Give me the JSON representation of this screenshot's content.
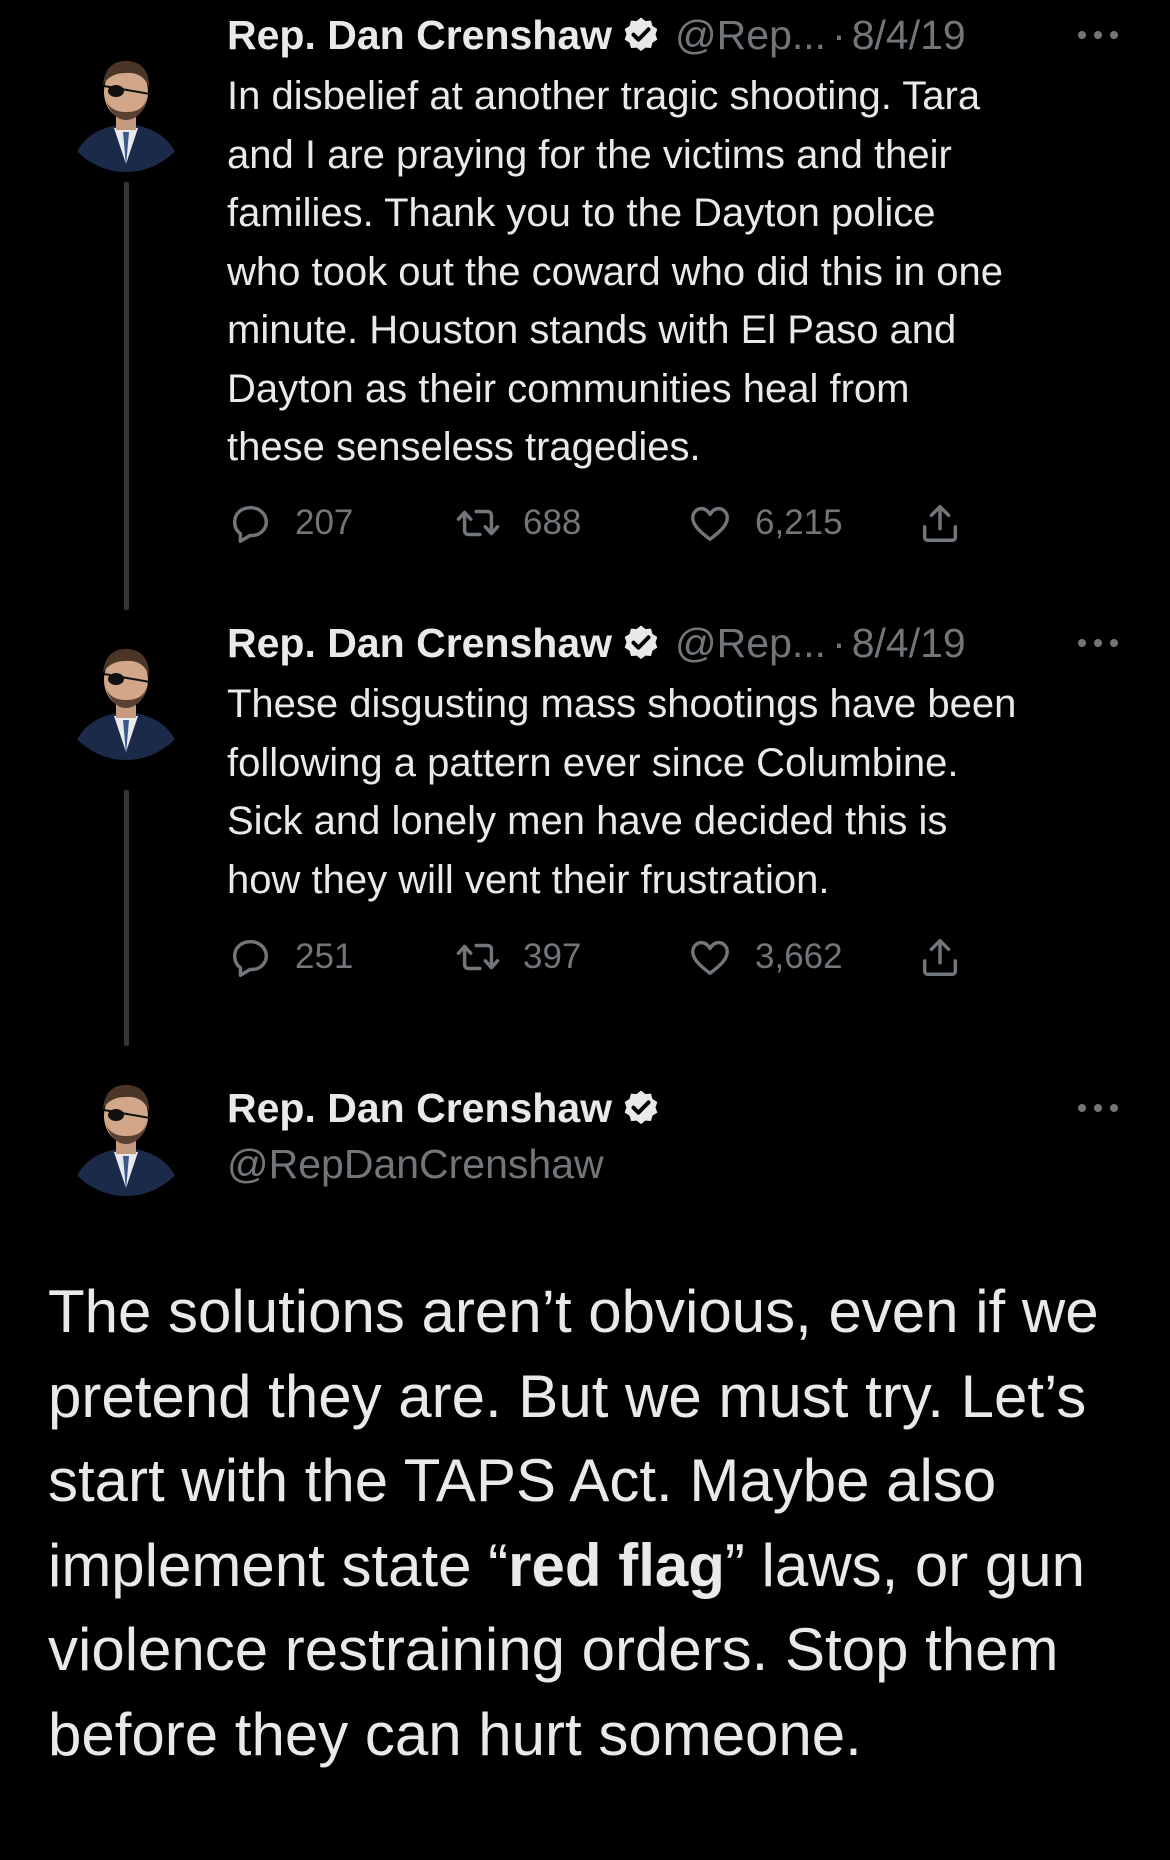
{
  "colors": {
    "background": "#000000",
    "text": "#e7e9ea",
    "secondary_text": "#71767b",
    "thread_line": "#333639",
    "verified_badge": "#e7e9ea"
  },
  "tweets": [
    {
      "name": "Rep. Dan Crenshaw",
      "handle": "@Rep...",
      "separator": "·",
      "date": "8/4/19",
      "text": "In disbelief at another tragic shooting. Tara\nand I are praying for the victims and their\nfamilies. Thank you to the Dayton police\nwho took out the coward who did this in one\nminute. Houston stands with El Paso and\nDayton as their communities heal from\nthese senseless tragedies.",
      "replies": "207",
      "retweets": "688",
      "likes": "6,215"
    },
    {
      "name": "Rep. Dan Crenshaw",
      "handle": "@Rep...",
      "separator": "·",
      "date": "8/4/19",
      "text": "These disgusting mass shootings have been\nfollowing a pattern ever since Columbine.\nSick and lonely men have decided this is\nhow they will vent their frustration.",
      "replies": "251",
      "retweets": "397",
      "likes": "3,662"
    }
  ],
  "main_tweet": {
    "name": "Rep. Dan Crenshaw",
    "handle": "@RepDanCrenshaw",
    "text_before": "The solutions aren’t obvious, even if we pretend they are. But we must try. Let’s start with the TAPS Act. Maybe also implement state “",
    "text_bold": "red flag",
    "text_after": "” laws, or gun violence restraining orders. Stop them before they can hurt someone."
  },
  "icons": {
    "verified": "verified-badge-icon",
    "more": "more-options-icon",
    "reply": "reply-icon",
    "retweet": "retweet-icon",
    "like": "like-icon",
    "share": "share-icon"
  }
}
